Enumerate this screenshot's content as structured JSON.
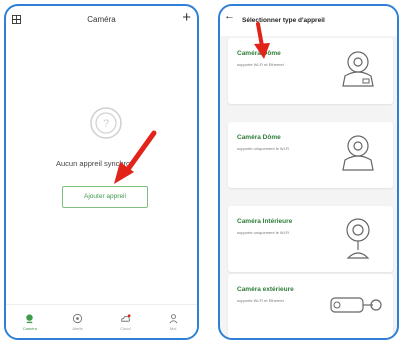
{
  "left": {
    "title": "Caméra",
    "empty_text": "Aucun appreil synchro",
    "add_button": "Ajouter appreil",
    "tabs": [
      {
        "label": "Caméra",
        "icon": "camera-icon",
        "active": true
      },
      {
        "label": "Alerte",
        "icon": "alert-icon",
        "active": false
      },
      {
        "label": "Cloud",
        "icon": "cloud-icon",
        "active": false
      },
      {
        "label": "Moi",
        "icon": "user-icon",
        "active": false
      }
    ]
  },
  "right": {
    "title": "Sélectionner type d'appreil",
    "cards": [
      {
        "name": "Caméra Dôme",
        "desc": "supporte Wi-Fi et Ethernet",
        "icon": "dome-camera-ethernet-icon"
      },
      {
        "name": "Caméra Dôme",
        "desc": "supporte uniquement le Wi-Fi",
        "icon": "dome-camera-icon"
      },
      {
        "name": "Caméra Intérieure",
        "desc": "supporte uniquement le Wi-Fi",
        "icon": "indoor-camera-icon"
      },
      {
        "name": "Caméra extérieure",
        "desc": "supporte Wi-Fi et Ethernet",
        "icon": "bullet-camera-icon"
      }
    ]
  },
  "colors": {
    "accent_green": "#3f9a4a",
    "frame_blue": "#2f7fd6",
    "arrow_red": "#e2231a"
  }
}
